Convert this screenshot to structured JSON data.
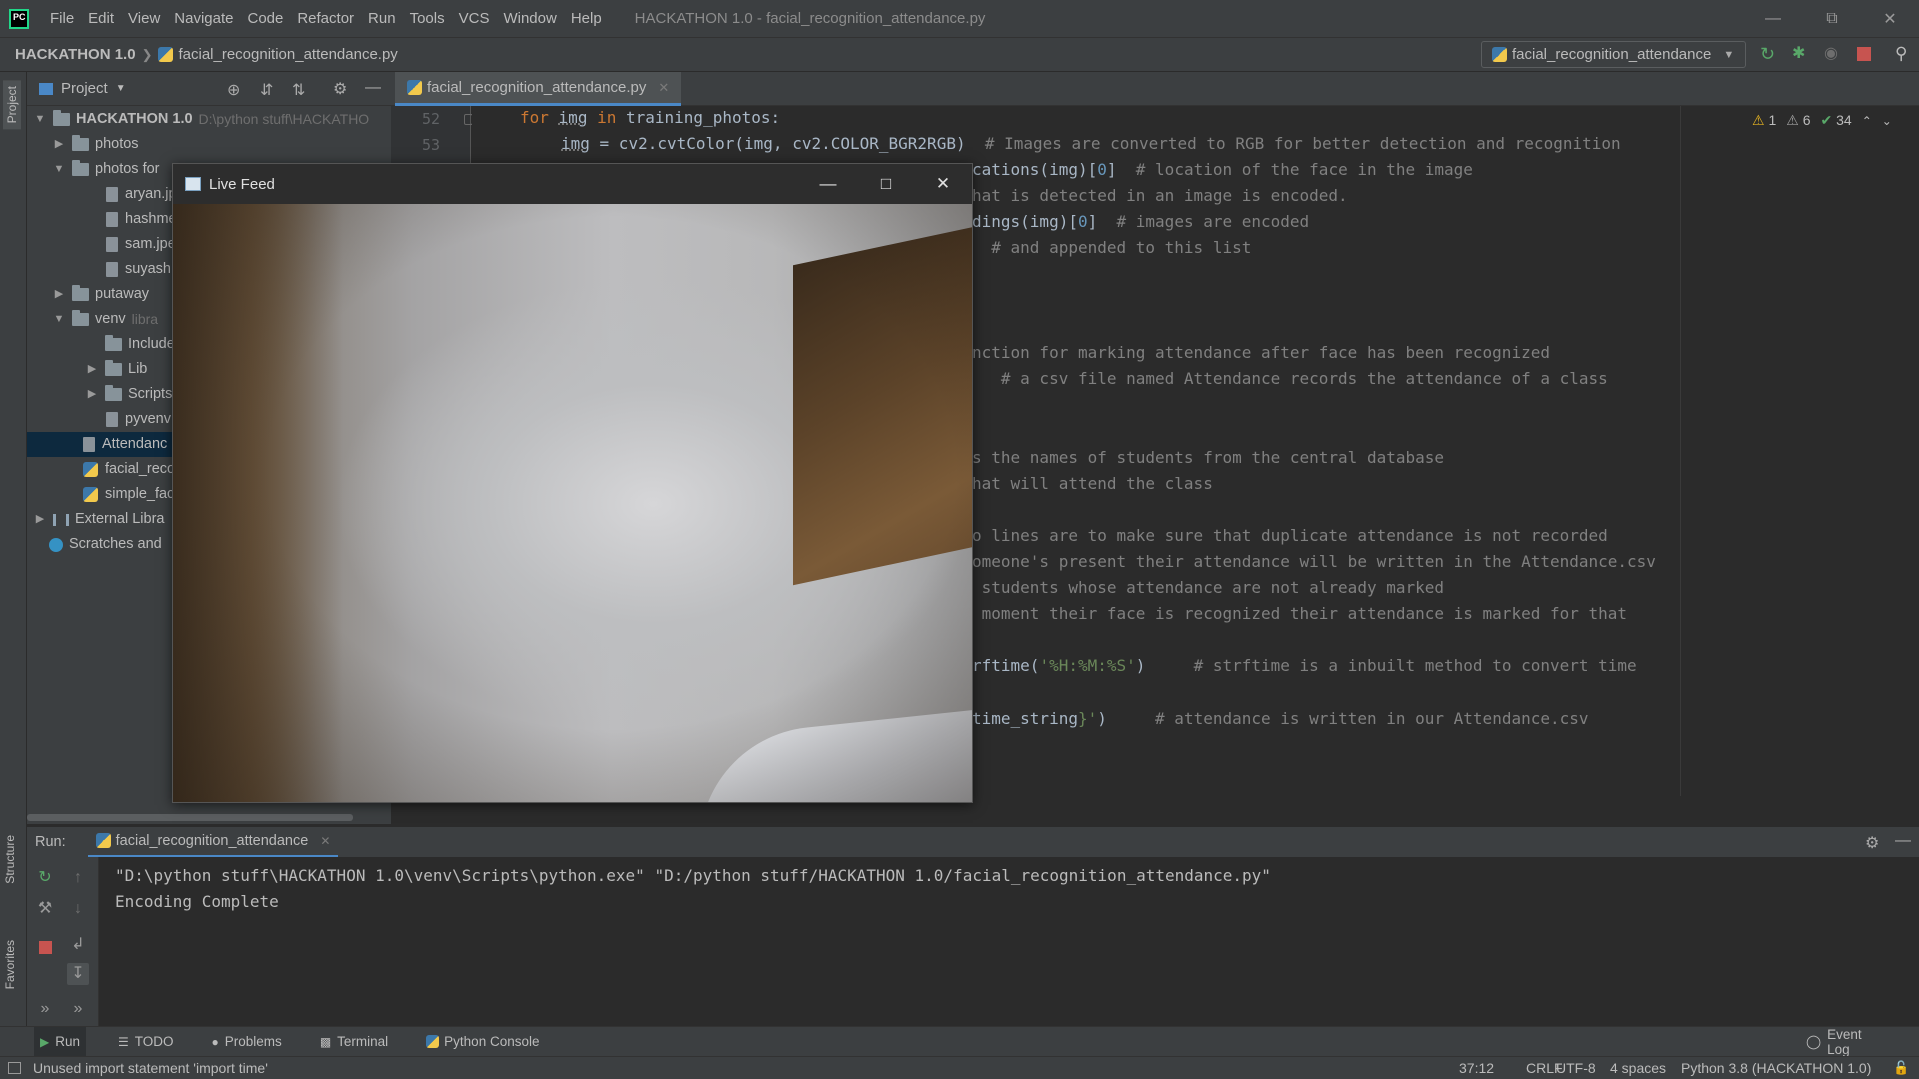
{
  "window": {
    "title": "HACKATHON 1.0 - facial_recognition_attendance.py",
    "menu": [
      "File",
      "Edit",
      "View",
      "Navigate",
      "Code",
      "Refactor",
      "Run",
      "Tools",
      "VCS",
      "Window",
      "Help"
    ]
  },
  "navbar": {
    "project": "HACKATHON 1.0",
    "file": "facial_recognition_attendance.py",
    "run_config": "facial_recognition_attendance"
  },
  "project_panel": {
    "title": "Project",
    "tree": [
      {
        "label": "HACKATHON 1.0",
        "hint": "D:\\python stuff\\HACKATHO",
        "expanded": true
      },
      {
        "label": "photos"
      },
      {
        "label": "photos for",
        "expanded": true
      },
      {
        "label": "aryan.jp"
      },
      {
        "label": "hashme"
      },
      {
        "label": "sam.jpe"
      },
      {
        "label": "suyash."
      },
      {
        "label": "putaway"
      },
      {
        "label": "venv",
        "hint": "libra",
        "expanded": true
      },
      {
        "label": "Include"
      },
      {
        "label": "Lib"
      },
      {
        "label": "Scripts"
      },
      {
        "label": "pyvenv"
      },
      {
        "label": "Attendanc"
      },
      {
        "label": "facial_reco"
      },
      {
        "label": "simple_fac"
      },
      {
        "label": "External Libra"
      },
      {
        "label": "Scratches and"
      }
    ]
  },
  "editor": {
    "tab": "facial_recognition_attendance.py",
    "line_numbers": [
      "52",
      "53"
    ],
    "inspections": {
      "warnings": "1",
      "weak_warnings": "6",
      "ok": "34"
    },
    "visible_code": {
      "l52": {
        "kw1": "for",
        "var": "img",
        "kw2": "in",
        "rest": "training_photos:"
      },
      "l53": {
        "var": "img",
        "call": " = cv2.cvtColor(img, cv2.COLOR_BGR2RGB)",
        "comment": "  # Images are converted to RGB for better detection and recognition"
      },
      "l54": {
        "code": "cations(img)[",
        "num": "0",
        "code2": "]",
        "comment": "  # location of the face in the image"
      },
      "l55": {
        "comment": "hat is detected in an image is encoded."
      },
      "l56": {
        "code": "dings(img)[",
        "num": "0",
        "code2": "]",
        "comment": "  # images are encoded"
      },
      "l57": {
        "comment": "  # and appended to this list"
      },
      "l58": {
        "comment": "nction for marking attendance after face has been recognized"
      },
      "l59": {
        "comment": "   # a csv file named Attendance records the attendance of a class"
      },
      "l60": {
        "comment": "s the names of students from the central database"
      },
      "l61": {
        "comment": "hat will attend the class"
      },
      "l62": {
        "comment": "o lines are to make sure that duplicate attendance is not recorded"
      },
      "l63": {
        "comment": "omeone's present their attendance will be written in the Attendance.csv"
      },
      "l64": {
        "comment": " students whose attendance are not already marked"
      },
      "l65": {
        "comment": " moment their face is recognized their attendance is marked for that"
      },
      "l66": {
        "code": "rftime(",
        "str": "'%H:%M:%S'",
        "code2": ")",
        "comment": "     # strftime is a inbuilt method to convert time"
      },
      "l67": {
        "code": "time_string",
        "str": "}'",
        "code2": ")",
        "comment": "     # attendance is written in our Attendance.csv"
      }
    }
  },
  "live_feed": {
    "title": "Live Feed"
  },
  "run_panel": {
    "label": "Run:",
    "tab": "facial_recognition_attendance",
    "console": [
      "\"D:\\python stuff\\HACKATHON 1.0\\venv\\Scripts\\python.exe\" \"D:/python stuff/HACKATHON 1.0/facial_recognition_attendance.py\"",
      "Encoding Complete"
    ]
  },
  "left_strip": {
    "project": "Project",
    "structure": "Structure",
    "favorites": "Favorites"
  },
  "tool_tabs": [
    "Run",
    "TODO",
    "Problems",
    "Terminal",
    "Python Console"
  ],
  "event_log": "Event Log",
  "status": {
    "message": "Unused import statement 'import time'",
    "position": "37:12",
    "line_sep": "CRLF",
    "encoding": "UTF-8",
    "indent": "4 spaces",
    "interpreter": "Python 3.8 (HACKATHON 1.0)"
  },
  "colors": {
    "accent": "#4a88c7",
    "keyword": "#cc7832",
    "comment": "#808080",
    "string": "#6a8759",
    "number": "#6897bb"
  }
}
